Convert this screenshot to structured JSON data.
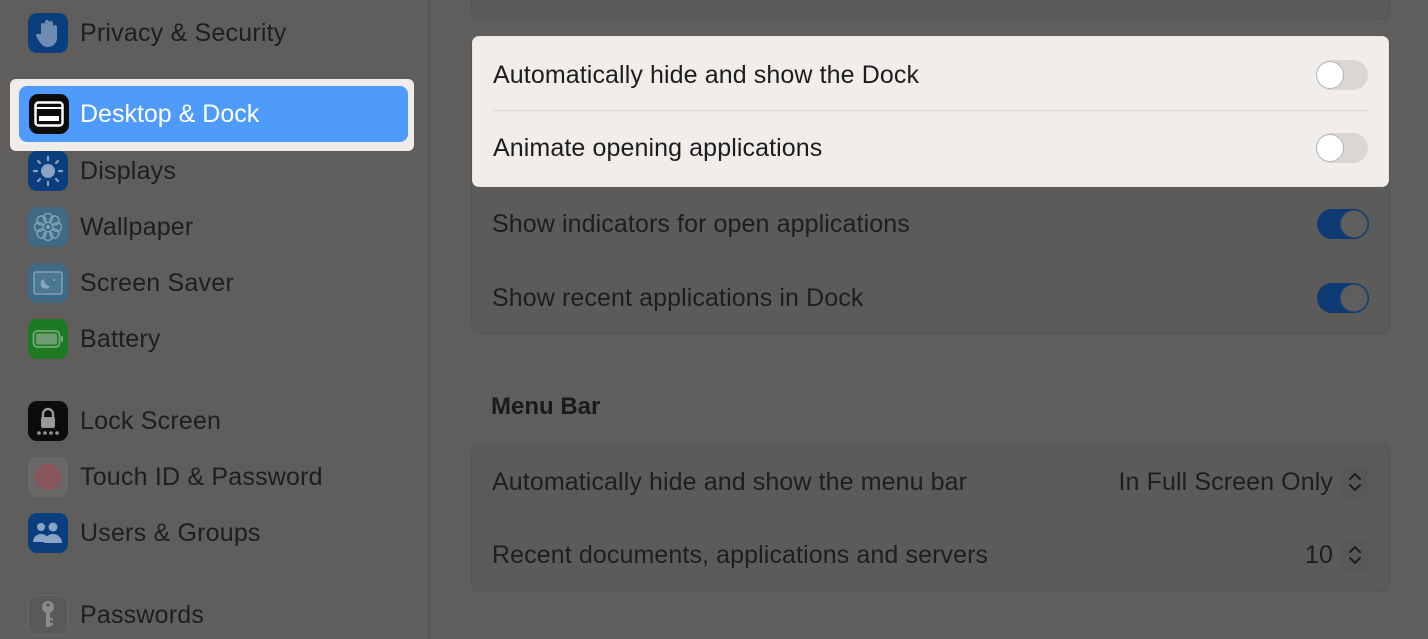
{
  "sidebar": {
    "items": [
      {
        "label": "Privacy & Security",
        "icon": "hand-icon",
        "color": "#0b3e7d"
      },
      {
        "label": "Desktop & Dock",
        "icon": "dock-icon",
        "color": "#0c0c0c",
        "selected": true
      },
      {
        "label": "Displays",
        "icon": "sun-icon",
        "color": "#0b3e7d"
      },
      {
        "label": "Wallpaper",
        "icon": "flower-icon",
        "color": "#3e6a86"
      },
      {
        "label": "Screen Saver",
        "icon": "screen-saver-icon",
        "color": "#3e6a86"
      },
      {
        "label": "Battery",
        "icon": "battery-icon",
        "color": "#1e7a22"
      },
      {
        "label": "Lock Screen",
        "icon": "lock-icon",
        "color": "#0c0c0c"
      },
      {
        "label": "Touch ID & Password",
        "icon": "fingerprint-icon",
        "color": "#6a6866"
      },
      {
        "label": "Users & Groups",
        "icon": "users-icon",
        "color": "#0b3e7d"
      },
      {
        "label": "Passwords",
        "icon": "key-icon",
        "color": "#5a5958"
      }
    ]
  },
  "dock_settings": {
    "rows": [
      {
        "label": "Automatically hide and show the Dock",
        "enabled": false
      },
      {
        "label": "Animate opening applications",
        "enabled": false
      },
      {
        "label": "Show indicators for open applications",
        "enabled": true
      },
      {
        "label": "Show recent applications in Dock",
        "enabled": true
      }
    ]
  },
  "menu_bar": {
    "title": "Menu Bar",
    "rows": [
      {
        "label": "Automatically hide and show the menu bar",
        "value": "In Full Screen Only"
      },
      {
        "label": "Recent documents, applications and servers",
        "value": "10"
      }
    ]
  },
  "colors": {
    "accent": "#4f9bfb",
    "toggle_on": "#0d3a73",
    "highlight_bg": "#f0edeb",
    "dim_bg": "#5f5e5c"
  }
}
